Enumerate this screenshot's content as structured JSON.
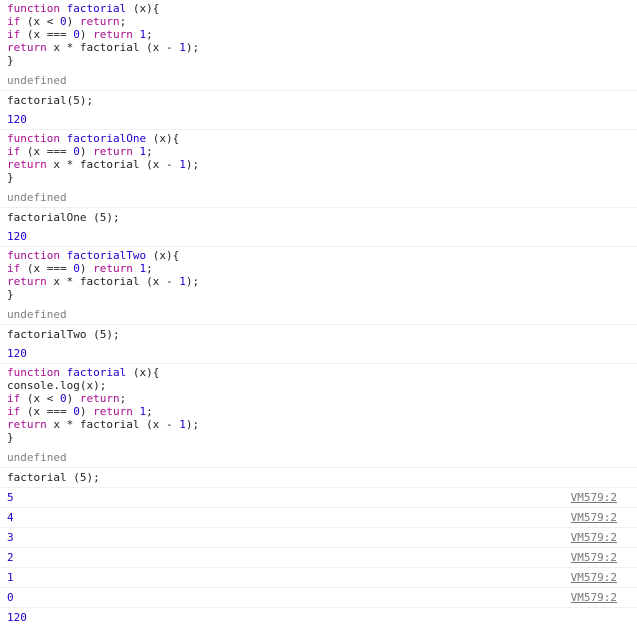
{
  "entries": [
    {
      "lines": [
        [
          [
            "kw",
            "function "
          ],
          [
            "fn",
            "factorial"
          ],
          [
            "plain",
            " (x){"
          ]
        ],
        [
          [
            "kw",
            "if"
          ],
          [
            "plain",
            " (x < "
          ],
          [
            "num",
            "0"
          ],
          [
            "plain",
            ") "
          ],
          [
            "kw",
            "return"
          ],
          [
            "plain",
            ";"
          ]
        ],
        [
          [
            "kw",
            "if"
          ],
          [
            "plain",
            " (x === "
          ],
          [
            "num",
            "0"
          ],
          [
            "plain",
            ") "
          ],
          [
            "kw",
            "return "
          ],
          [
            "num",
            "1"
          ],
          [
            "plain",
            ";"
          ]
        ],
        [
          [
            "kw",
            "return"
          ],
          [
            "plain",
            " x * factorial (x - "
          ],
          [
            "num",
            "1"
          ],
          [
            "plain",
            ");"
          ]
        ],
        [
          [
            "plain",
            "}"
          ]
        ]
      ],
      "result": "undefined"
    },
    {
      "command": "factorial(5);",
      "result": "120"
    },
    {
      "lines": [
        [
          [
            "kw",
            "function "
          ],
          [
            "fn",
            "factorialOne"
          ],
          [
            "plain",
            " (x){"
          ]
        ],
        [
          [
            "kw",
            "if"
          ],
          [
            "plain",
            " (x === "
          ],
          [
            "num",
            "0"
          ],
          [
            "plain",
            ") "
          ],
          [
            "kw",
            "return "
          ],
          [
            "num",
            "1"
          ],
          [
            "plain",
            ";"
          ]
        ],
        [
          [
            "kw",
            "return"
          ],
          [
            "plain",
            " x * factorial (x - "
          ],
          [
            "num",
            "1"
          ],
          [
            "plain",
            ");"
          ]
        ],
        [
          [
            "plain",
            "}"
          ]
        ]
      ],
      "result": "undefined"
    },
    {
      "command": "factorialOne (5);",
      "result": "120"
    },
    {
      "lines": [
        [
          [
            "kw",
            "function "
          ],
          [
            "fn",
            "factorialTwo"
          ],
          [
            "plain",
            " (x){"
          ]
        ],
        [
          [
            "kw",
            "if"
          ],
          [
            "plain",
            " (x === "
          ],
          [
            "num",
            "0"
          ],
          [
            "plain",
            ") "
          ],
          [
            "kw",
            "return "
          ],
          [
            "num",
            "1"
          ],
          [
            "plain",
            ";"
          ]
        ],
        [
          [
            "kw",
            "return"
          ],
          [
            "plain",
            " x * factorial (x - "
          ],
          [
            "num",
            "1"
          ],
          [
            "plain",
            ");"
          ]
        ],
        [
          [
            "plain",
            "}"
          ]
        ]
      ],
      "result": "undefined"
    },
    {
      "command": "factorialTwo (5);",
      "result": "120"
    },
    {
      "lines": [
        [
          [
            "kw",
            "function "
          ],
          [
            "fn",
            "factorial"
          ],
          [
            "plain",
            " (x){"
          ]
        ],
        [
          [
            "plain",
            "console.log(x);"
          ]
        ],
        [
          [
            "kw",
            "if"
          ],
          [
            "plain",
            " (x < "
          ],
          [
            "num",
            "0"
          ],
          [
            "plain",
            ") "
          ],
          [
            "kw",
            "return"
          ],
          [
            "plain",
            ";"
          ]
        ],
        [
          [
            "kw",
            "if"
          ],
          [
            "plain",
            " (x === "
          ],
          [
            "num",
            "0"
          ],
          [
            "plain",
            ") "
          ],
          [
            "kw",
            "return "
          ],
          [
            "num",
            "1"
          ],
          [
            "plain",
            ";"
          ]
        ],
        [
          [
            "kw",
            "return"
          ],
          [
            "plain",
            " x * factorial (x - "
          ],
          [
            "num",
            "1"
          ],
          [
            "plain",
            ");"
          ]
        ],
        [
          [
            "plain",
            "}"
          ]
        ]
      ],
      "result": "undefined"
    }
  ],
  "final_command": "factorial (5);",
  "logs": [
    {
      "value": "5",
      "source": "VM579:2"
    },
    {
      "value": "4",
      "source": "VM579:2"
    },
    {
      "value": "3",
      "source": "VM579:2"
    },
    {
      "value": "2",
      "source": "VM579:2"
    },
    {
      "value": "1",
      "source": "VM579:2"
    },
    {
      "value": "0",
      "source": "VM579:2"
    }
  ],
  "final_result": "120",
  "colors": {
    "keyword": "#aa0d91",
    "number": "#1c00cf",
    "muted": "#808080",
    "link": "#777777"
  }
}
